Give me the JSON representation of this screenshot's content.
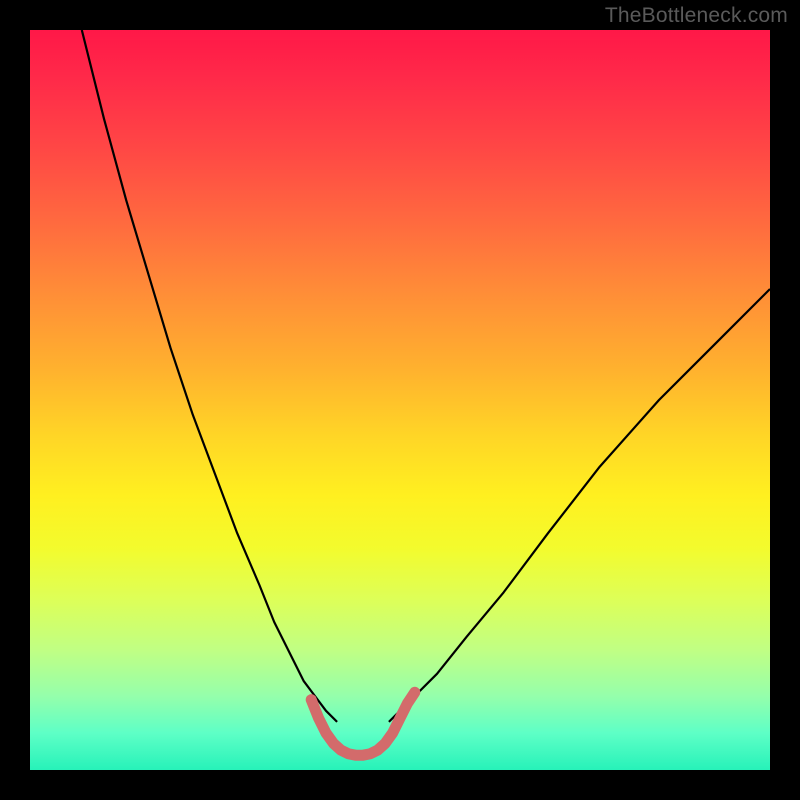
{
  "watermark": "TheBottleneck.com",
  "chart_data": {
    "type": "line",
    "title": "",
    "xlabel": "",
    "ylabel": "",
    "xlim": [
      0,
      100
    ],
    "ylim": [
      0,
      100
    ],
    "gradient_stops": [
      {
        "pos": 0,
        "color": "#ff1848"
      },
      {
        "pos": 26,
        "color": "#ff6a3f"
      },
      {
        "pos": 55,
        "color": "#ffd626"
      },
      {
        "pos": 77,
        "color": "#ddff58"
      },
      {
        "pos": 100,
        "color": "#27f2b9"
      }
    ],
    "series": [
      {
        "name": "curve-left",
        "color": "#000000",
        "width": 2.2,
        "x": [
          7,
          10,
          13,
          16,
          19,
          22,
          25,
          28,
          31,
          33,
          35,
          37,
          38.5,
          40,
          41.5
        ],
        "y": [
          100,
          88,
          77,
          67,
          57,
          48,
          40,
          32,
          25,
          20,
          16,
          12,
          10,
          8,
          6.5
        ]
      },
      {
        "name": "curve-right",
        "color": "#000000",
        "width": 2.2,
        "x": [
          48.5,
          50,
          52,
          55,
          59,
          64,
          70,
          77,
          85,
          93,
          100
        ],
        "y": [
          6.5,
          8,
          10,
          13,
          18,
          24,
          32,
          41,
          50,
          58,
          65
        ]
      },
      {
        "name": "optimal-band",
        "color": "#d36b6b",
        "width": 11,
        "linecap": "round",
        "x": [
          38,
          39,
          40,
          41,
          42,
          43,
          44,
          45,
          46,
          47,
          48,
          49,
          50,
          51,
          52
        ],
        "y": [
          9.5,
          7.0,
          5.0,
          3.6,
          2.7,
          2.2,
          2.0,
          2.0,
          2.2,
          2.7,
          3.6,
          5.0,
          7.0,
          9.0,
          10.5
        ]
      }
    ]
  }
}
